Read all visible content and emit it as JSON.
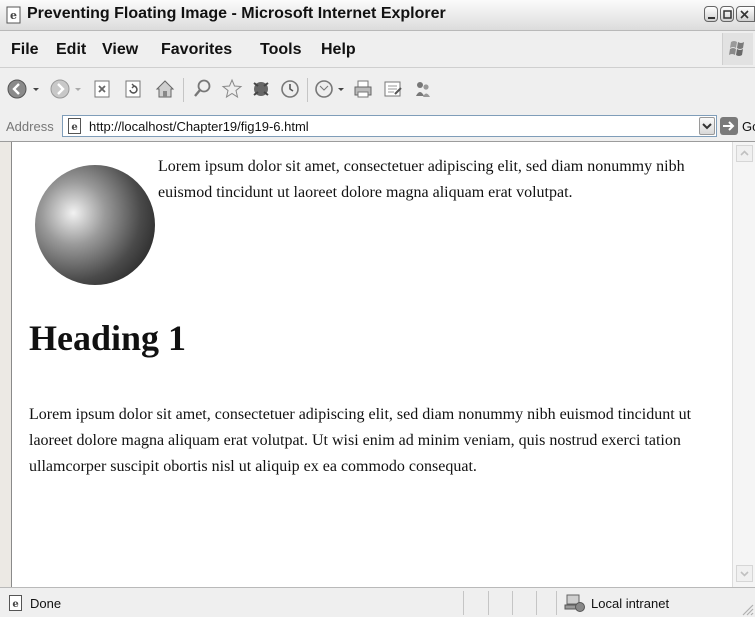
{
  "window": {
    "title": "Preventing Floating Image - Microsoft Internet Explorer"
  },
  "menu": {
    "items": [
      "File",
      "Edit",
      "View",
      "Favorites",
      "Tools",
      "Help"
    ]
  },
  "toolbar": {
    "buttons": [
      "back-icon",
      "forward-icon",
      "stop-icon",
      "refresh-icon",
      "home-icon",
      "search-icon",
      "favorites-icon",
      "media-icon",
      "history-icon",
      "mail-icon",
      "print-icon",
      "edit-icon",
      "messenger-icon"
    ]
  },
  "address": {
    "label": "Address",
    "url": "http://localhost/Chapter19/fig19-6.html",
    "go_label": "Go"
  },
  "content": {
    "floated_paragraph": "Lorem ipsum dolor sit amet, consectetuer adipiscing elit, sed diam nonummy nibh euismod tincidunt ut laoreet dolore magna aliquam erat volutpat.",
    "heading": "Heading 1",
    "paragraph": "Lorem ipsum dolor sit amet, consectetuer adipiscing elit, sed diam nonummy nibh euismod tincidunt ut laoreet dolore magna aliquam erat volutpat. Ut wisi enim ad minim veniam, quis nostrud exerci tation ullamcorper suscipit obortis nisl ut aliquip ex ea commodo consequat."
  },
  "status": {
    "text": "Done",
    "zone": "Local intranet"
  }
}
